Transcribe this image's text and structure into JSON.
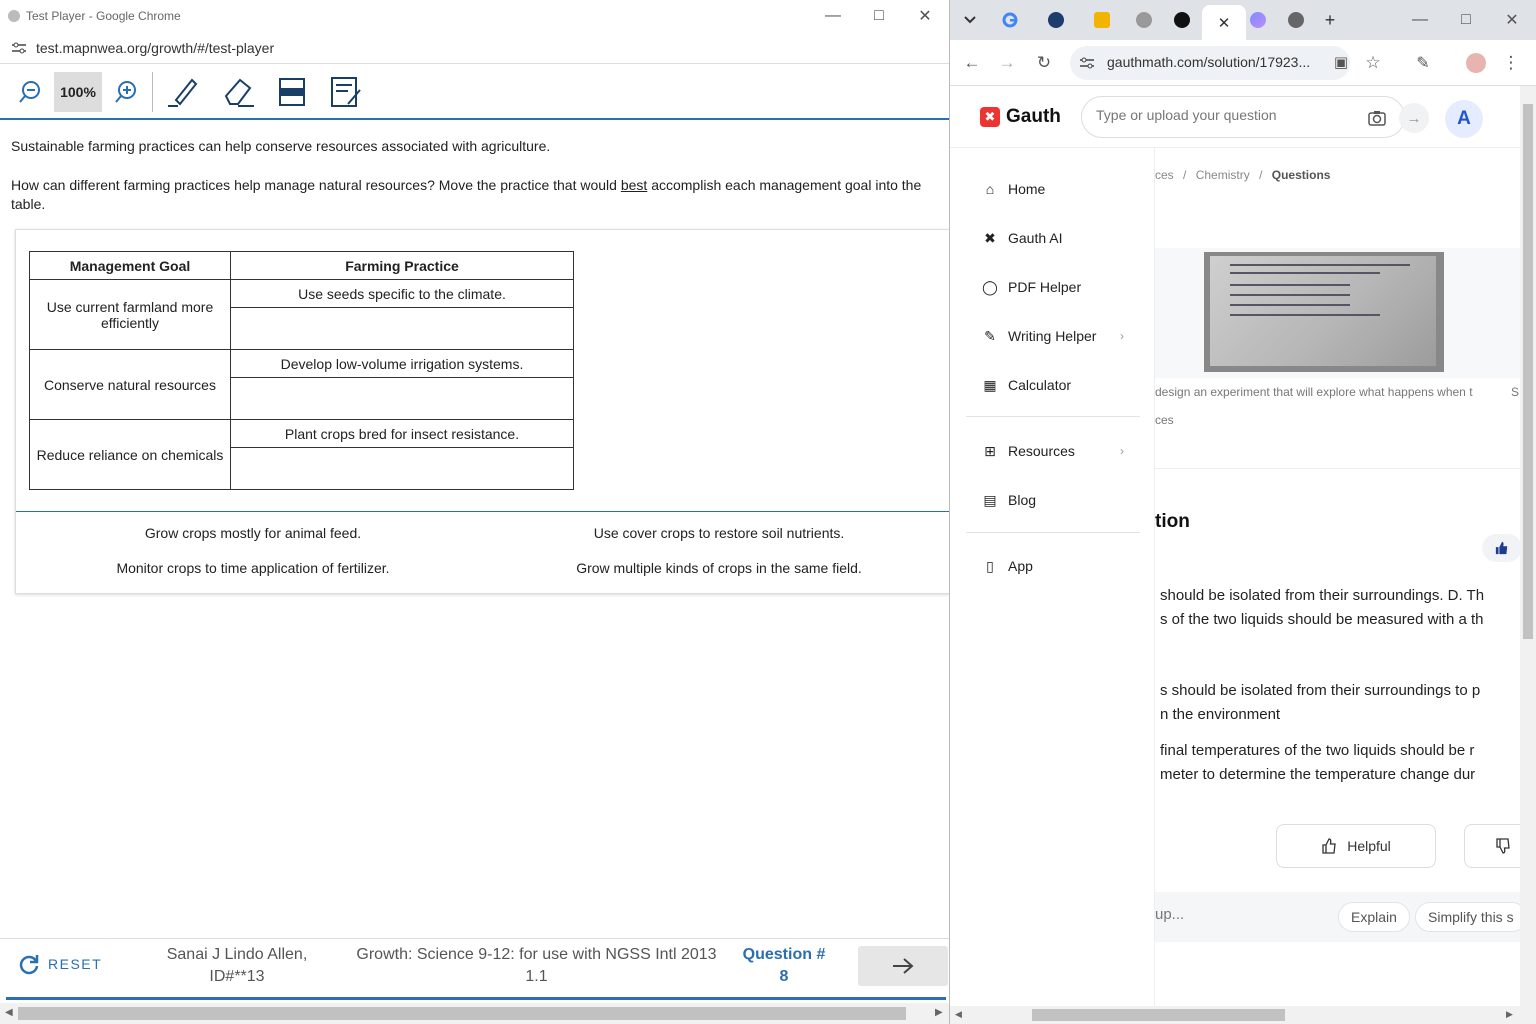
{
  "left_window": {
    "title": "Test Player - Google Chrome",
    "url": "test.mapnwea.org/growth/#/test-player",
    "zoom": "100%",
    "question_intro": "Sustainable farming practices can help conserve resources associated with agriculture.",
    "question_pre": "How can different farming practices help manage natural resources? Move the practice that would ",
    "question_emph": "best",
    "question_post": " accomplish each management goal into the table.",
    "table": {
      "headers": [
        "Management Goal",
        "Farming Practice"
      ],
      "rows": [
        {
          "goal": "Use current farmland more efficiently",
          "practice": "Use seeds specific to the climate."
        },
        {
          "goal": "Conserve natural resources",
          "practice": "Develop low-volume irrigation systems."
        },
        {
          "goal": "Reduce reliance on chemicals",
          "practice": "Plant crops bred for insect resistance."
        }
      ]
    },
    "options": [
      "Grow crops mostly for animal feed.",
      "Use cover crops to restore soil nutrients.",
      "Monitor crops to time application of fertilizer.",
      "Grow multiple kinds of crops in the same field."
    ],
    "footer": {
      "reset": "RESET",
      "student_line1": "Sanai J Lindo Allen,",
      "student_line2": "ID#**13",
      "test_line1": "Growth: Science 9-12: for use with NGSS Intl 2013",
      "test_line2": "1.1",
      "question_label": "Question #",
      "question_number": "8"
    }
  },
  "right_window": {
    "url": "gauthmath.com/solution/17923...",
    "brand": "Gauth",
    "search_placeholder": "Type or upload your question",
    "avatar_letter": "A",
    "sidebar": [
      {
        "label": "Home",
        "icon": "home-icon"
      },
      {
        "label": "Gauth AI",
        "icon": "gauth-ai-icon"
      },
      {
        "label": "PDF Helper",
        "icon": "pdf-icon"
      },
      {
        "label": "Writing Helper",
        "icon": "pen-icon"
      },
      {
        "label": "Calculator",
        "icon": "calculator-icon"
      },
      {
        "label": "Resources",
        "icon": "grid-icon"
      },
      {
        "label": "Blog",
        "icon": "blog-icon"
      },
      {
        "label": "App",
        "icon": "phone-icon"
      }
    ],
    "breadcrumb": {
      "prefix": "ces",
      "sep": "/",
      "subject": "Chemistry",
      "current": "Questions"
    },
    "caption": "design an experiment that will explore what happens when t",
    "caption_tail": "S",
    "caption2": "ces",
    "heading": "tion",
    "answer_lines": [
      "should be isolated from their surroundings. D. Th",
      "s of the two liquids should be measured with a th",
      "s should be isolated from their surroundings to p",
      "n the environment",
      "final temperatures of the two liquids should be r",
      "meter to determine the temperature change dur"
    ],
    "helpful": "Helpful",
    "chat_placeholder": "up...",
    "chips": [
      "Explain",
      "Simplify this s"
    ]
  }
}
